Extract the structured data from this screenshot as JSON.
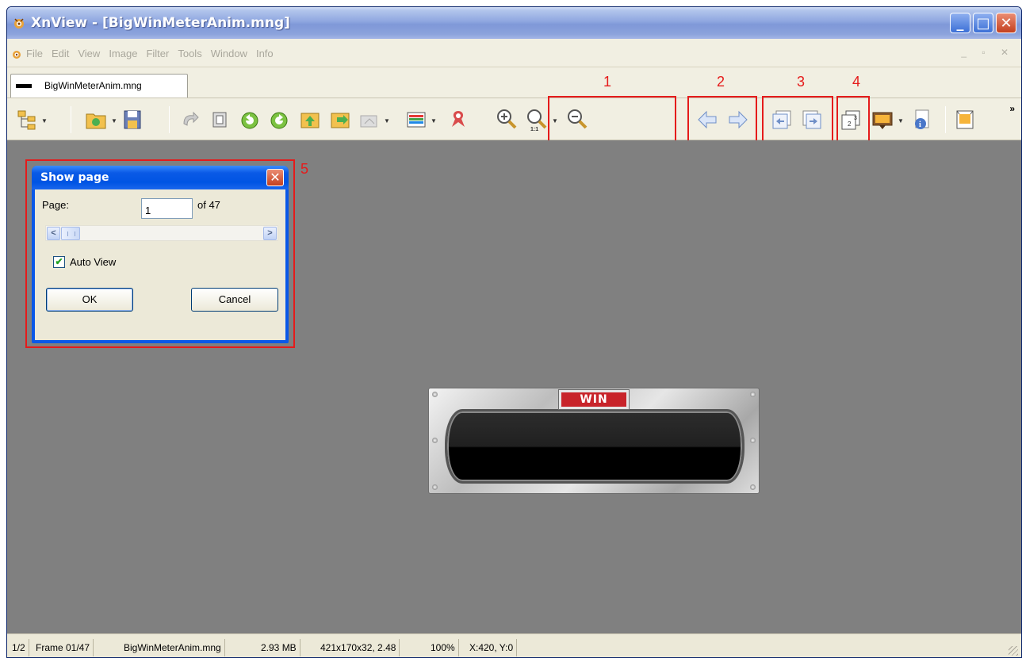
{
  "window": {
    "title": "XnView - [BigWinMeterAnim.mng]",
    "min_label": "_",
    "max_label": "□",
    "close_label": "✕"
  },
  "menubar": {
    "items": [
      "File",
      "Edit",
      "View",
      "Image",
      "Filter",
      "Tools",
      "Window",
      "Info"
    ],
    "mdi_controls": "_ ▫ ✕"
  },
  "tab": {
    "label": "BigWinMeterAnim.mng"
  },
  "toolbar": {
    "icons": [
      "browser-tree",
      "open-folder",
      "save",
      "undo",
      "crop",
      "rotate-left",
      "rotate-right",
      "send-up",
      "send-file",
      "scan",
      "adjust-color",
      "red-eye",
      "zoom-in",
      "zoom-1-1",
      "zoom-out",
      "previous",
      "next",
      "previous-frame",
      "next-frame",
      "show-page",
      "slideshow",
      "properties",
      "fullscreen"
    ],
    "more": "»"
  },
  "callouts": [
    "1",
    "2",
    "3",
    "4",
    "5"
  ],
  "image": {
    "win_text": "WIN"
  },
  "dialog": {
    "title": "Show page",
    "close": "✕",
    "page_label": "Page:",
    "page_value": "1",
    "of_label": "of 47",
    "scroll_left": "<",
    "scroll_right": ">",
    "auto_view_label": "Auto View",
    "auto_view_checked": true,
    "ok_label": "OK",
    "cancel_label": "Cancel"
  },
  "statusbar": {
    "cells": [
      "1/2",
      "Frame 01/47",
      "BigWinMeterAnim.mng",
      "2.93 MB",
      "421x170x32, 2.48",
      "100%",
      "X:420, Y:0"
    ]
  },
  "colors": {
    "callout": "#e51b1b",
    "viewport": "#808080",
    "xp_blue": "#0054e3"
  }
}
